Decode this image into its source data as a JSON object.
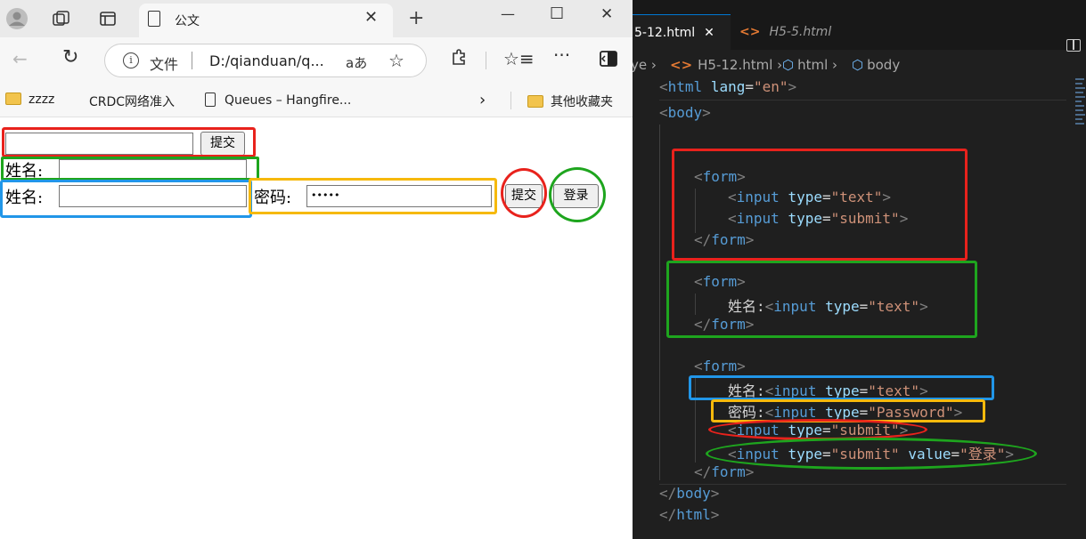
{
  "browser": {
    "tab": {
      "title": "公文",
      "close_icon": "close-icon"
    },
    "new_tab_icon": "plus-icon",
    "address": {
      "label": "文件",
      "url": "D:/qianduan/q...",
      "read_aloud": "aあ"
    },
    "favorites": [
      {
        "label": "zzzz",
        "icon": "folder-icon"
      },
      {
        "label": "CRDC网络准入",
        "icon": "blank-icon"
      },
      {
        "label": "Queues – Hangfire...",
        "icon": "document-icon"
      },
      {
        "label": "其他收藏夹",
        "icon": "folder-icon"
      }
    ],
    "page": {
      "form1": {
        "submit_label": "提交"
      },
      "form2": {
        "name_label": "姓名:"
      },
      "form3": {
        "name_label": "姓名:",
        "password_label": "密码:",
        "password_value": "•••••",
        "submit_label": "提交",
        "login_label": "登录"
      }
    },
    "colors": {
      "red": "#e8221c",
      "green": "#1ea51e",
      "blue": "#2196e8",
      "yellow": "#f6b90c"
    }
  },
  "editor": {
    "tabs": [
      {
        "label": "5-12.html",
        "active": true
      },
      {
        "label": "H5-5.html",
        "active": false
      }
    ],
    "breadcrumb": {
      "root": "ye",
      "file": "H5-12.html",
      "html": "html",
      "body": "body"
    },
    "code": {
      "html_open": {
        "tag": "html",
        "attr": "lang",
        "value": "\"en\""
      },
      "body_open": "body",
      "form1": {
        "input1_type": "\"text\"",
        "input2_type": "\"submit\""
      },
      "form2": {
        "label": "姓名:",
        "input_type": "\"text\""
      },
      "form3": {
        "name_label": "姓名:",
        "name_type": "\"text\"",
        "pwd_label": "密码:",
        "pwd_type": "\"Password\"",
        "submit_type": "\"submit\"",
        "login_type": "\"submit\"",
        "login_value": "\"登录\""
      },
      "body_close": "body",
      "html_close": "html"
    }
  }
}
